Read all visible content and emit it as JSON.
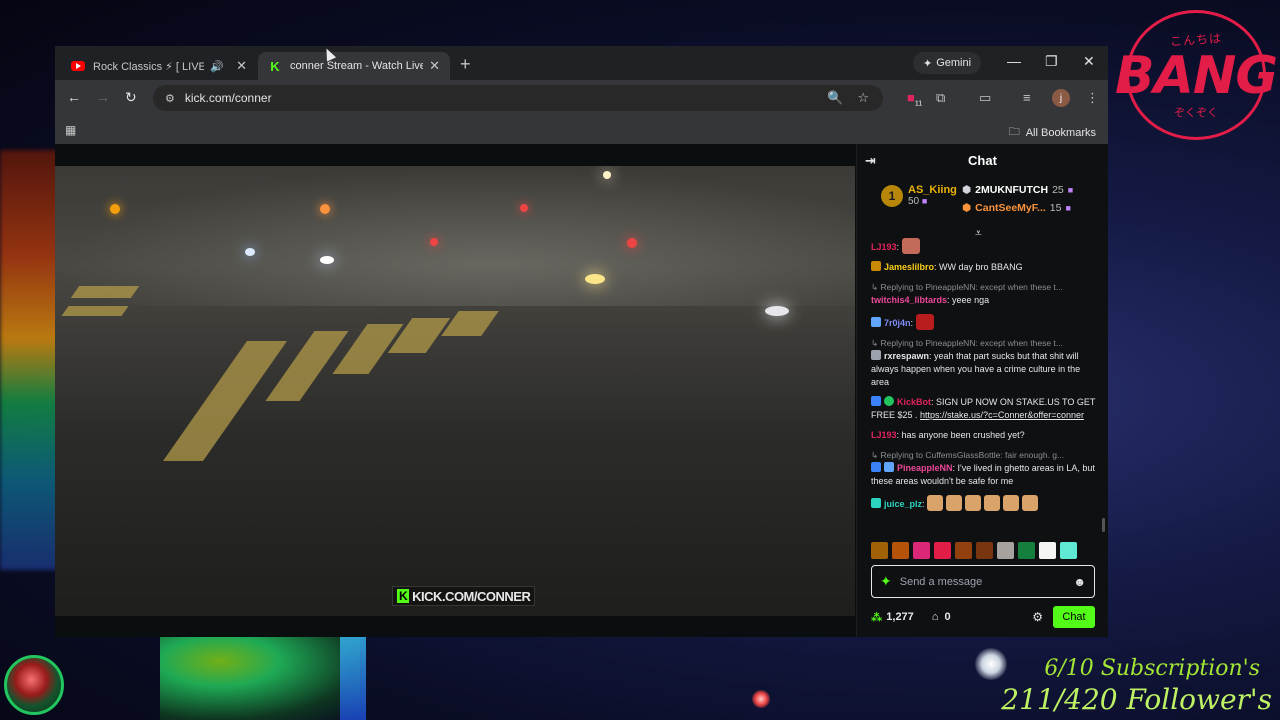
{
  "overlay": {
    "logo_top": "こんちは",
    "logo_text": "BANG",
    "logo_bottom": "ぞくぞく",
    "subscriptions": "6/10 Subscription's",
    "followers": "211/420 Follower's"
  },
  "browser": {
    "tabs": [
      {
        "title": "Rock Classics ⚡ [ LIVE ] Tin",
        "favicon": "youtube-icon",
        "audio": true
      },
      {
        "title": "conner Stream - Watch Live on",
        "favicon": "kick-icon",
        "active": true
      }
    ],
    "gemini_label": "Gemini",
    "url": "kick.com/conner",
    "extension_badge": "11",
    "profile_initial": "j",
    "all_bookmarks": "All Bookmarks"
  },
  "video": {
    "watermark": "KICK.COM/CONNER"
  },
  "chat": {
    "title": "Chat",
    "leaderboard": {
      "first": {
        "rank": "1",
        "name": "AS_Kiing",
        "points": "50"
      },
      "second": {
        "name": "2MUKNFUTCH",
        "points": "25"
      },
      "third": {
        "name": "CantSeeMyF...",
        "points": "15"
      }
    },
    "messages": [
      {
        "user": "LJ193",
        "user_color": "#e0245e",
        "text": "",
        "emote": true
      },
      {
        "user": "Jameslilbro",
        "user_color": "#facc15",
        "text": "WW day bro BBANG"
      },
      {
        "reply": "Replying to PineappleNN: except when these t...",
        "user": "twitchis4_libtards",
        "user_color": "#ec4899",
        "text": "yeee nga"
      },
      {
        "user": "7r0j4n",
        "user_color": "#818cf8",
        "text": "",
        "emote": true
      },
      {
        "reply": "Replying to PineappleNN: except when these t...",
        "user": "rxrespawn",
        "user_color": "#e5e7eb",
        "text": "yeah that part sucks but that shit will always happen when you have a crime culture in the area"
      },
      {
        "user": "KickBot",
        "user_color": "#e0245e",
        "text": "SIGN UP NOW ON STAKE.US TO GET FREE $25 . ",
        "link": "https://stake.us/?c=Conner&offer=conner"
      },
      {
        "user": "LJ193",
        "user_color": "#e0245e",
        "text": "has anyone been crushed yet?"
      },
      {
        "reply": "Replying to CuffemsGlassBottle: fair enough. g...",
        "user": "PineappleNN",
        "user_color": "#ec4899",
        "text": "I've lived in ghetto areas in LA, but these areas wouldn't be safe for me"
      },
      {
        "user": "juice_plz",
        "user_color": "#2dd4bf",
        "text": "",
        "emote_row": 6
      }
    ],
    "input_placeholder": "Send a message",
    "channel_points": "1,277",
    "store_count": "0",
    "chat_button": "Chat"
  }
}
